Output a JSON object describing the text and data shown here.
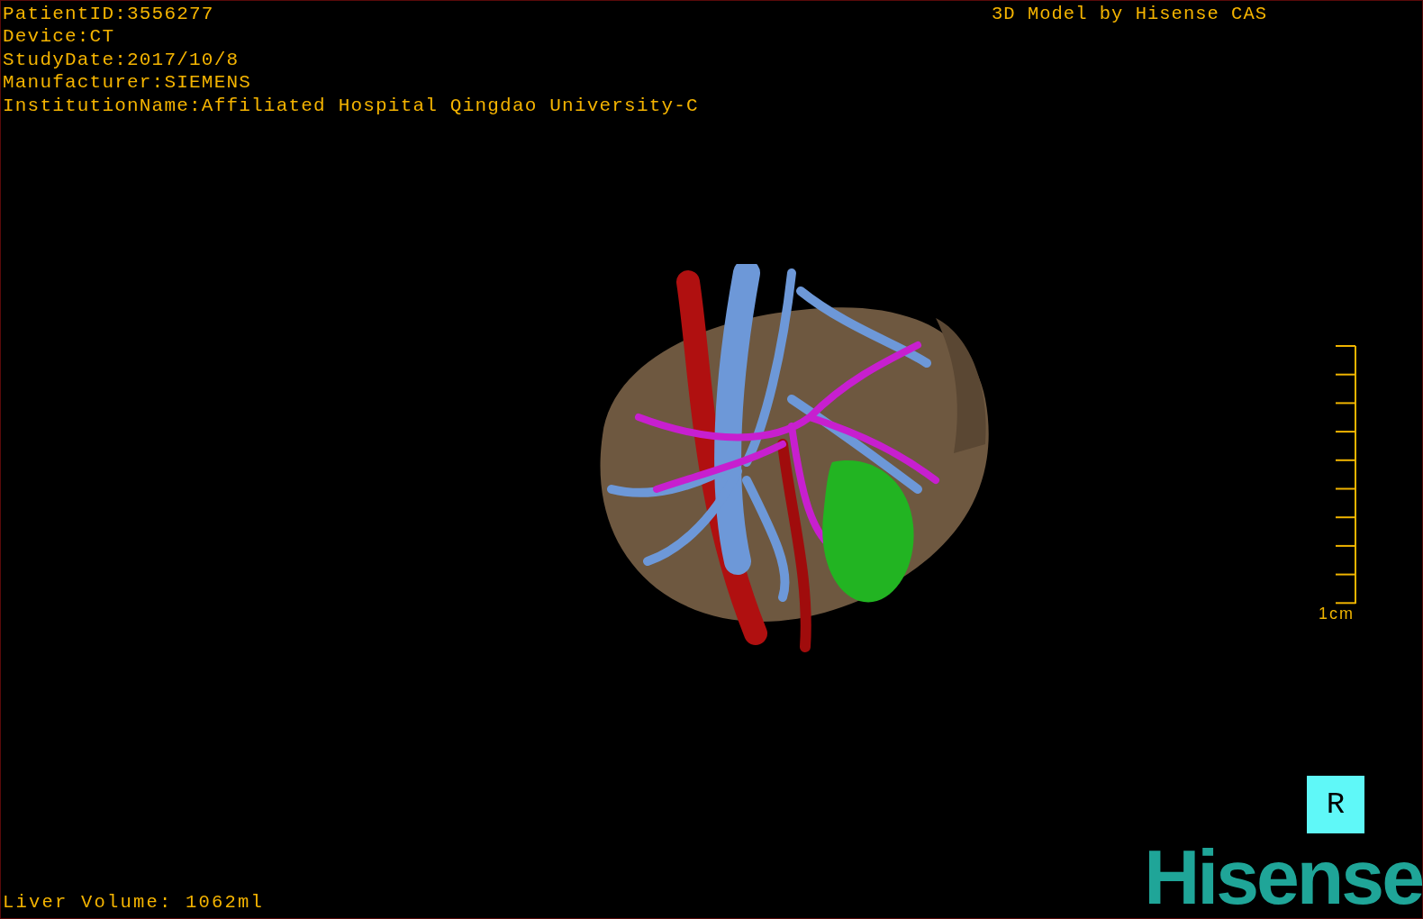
{
  "patient_info": [
    "PatientID:3556277",
    "Device:CT",
    "StudyDate:2017/10/8",
    "Manufacturer:SIEMENS",
    "InstitutionName:Affiliated Hospital Qingdao University-C"
  ],
  "credit": "3D Model by Hisense CAS",
  "scale_bar": {
    "label": "1cm"
  },
  "orientation_marker": {
    "label": "R"
  },
  "measurement": "Liver Volume: 1062ml",
  "logo": {
    "text": "Hisense"
  }
}
